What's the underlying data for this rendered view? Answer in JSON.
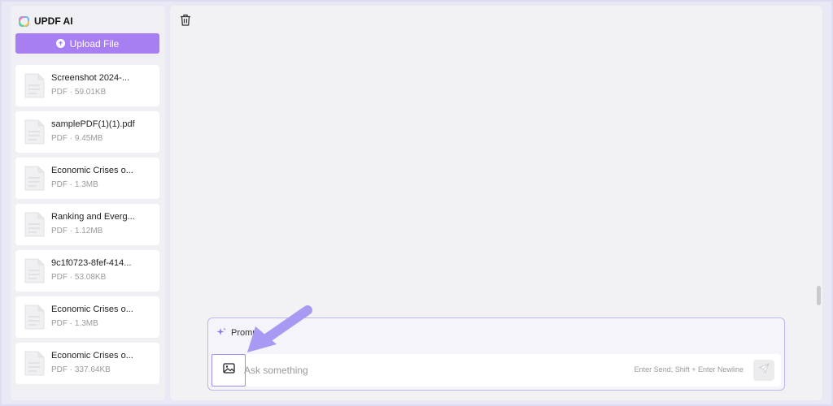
{
  "app": {
    "brand": "UPDF AI",
    "colors": {
      "accent": "#a77ff2",
      "arrow": "#a89af2",
      "border": "#b9b9ec"
    }
  },
  "sidebar": {
    "upload_label": "Upload File",
    "files": [
      {
        "name": "Screenshot 2024-...",
        "meta": "PDF · 59.01KB"
      },
      {
        "name": "samplePDF(1)(1).pdf",
        "meta": "PDF · 9.45MB"
      },
      {
        "name": "Economic Crises o...",
        "meta": "PDF · 1.3MB"
      },
      {
        "name": "Ranking and Everg...",
        "meta": "PDF · 1.12MB"
      },
      {
        "name": "9c1f0723-8fef-414...",
        "meta": "PDF · 53.08KB"
      },
      {
        "name": "Economic Crises o...",
        "meta": "PDF · 1.3MB"
      },
      {
        "name": "Economic Crises o...",
        "meta": "PDF · 337.64KB"
      }
    ]
  },
  "main": {
    "composer": {
      "prompt_label": "Promp",
      "placeholder": "Ask something",
      "hint": "Enter Send; Shift + Enter Newline"
    }
  },
  "icons": [
    "app-logo-icon",
    "upload-icon",
    "file-icon",
    "trash-icon",
    "sparkle-icon",
    "image-icon",
    "send-icon",
    "arrow-annotation"
  ]
}
